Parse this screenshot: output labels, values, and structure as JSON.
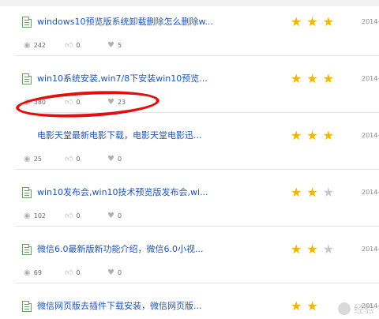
{
  "items": [
    {
      "title": "windows10预览版系统卸载删除怎么删除w...",
      "stars_on": 3,
      "date": "2014-",
      "views": "242",
      "likes": "0",
      "hearts": "5"
    },
    {
      "title": "win10系统安装,win7/8下安装win10预览...",
      "stars_on": 3,
      "date": "2014-",
      "views": "380",
      "likes": "0",
      "hearts": "23"
    },
    {
      "title": "电影天堂最新电影下载，电影天堂电影迅...",
      "stars_on": 3,
      "date": "2014-",
      "views": "25",
      "likes": "0",
      "hearts": "0"
    },
    {
      "title": "win10发布会,win10技术预览版发布会,wi...",
      "stars_on": 2,
      "date": "2014-",
      "views": "102",
      "likes": "0",
      "hearts": "0"
    },
    {
      "title": "微信6.0最新版新功能介绍，微信6.0小视...",
      "stars_on": 2,
      "date": "2014-",
      "views": "69",
      "likes": "0",
      "hearts": "0"
    },
    {
      "title": "微信网页版去插件下载安装，微信网页版...",
      "stars_on": 2,
      "date": "2014-",
      "views": "",
      "likes": "",
      "hearts": ""
    }
  ],
  "watermark": {
    "text": "经验"
  },
  "icons": {
    "view": "eye-icon",
    "like": "thumbs-up-icon",
    "heart": "heart-icon",
    "file": "document-icon"
  },
  "colors": {
    "title_link": "#2255aa",
    "star_on": "#f5b400",
    "star_off": "#c8c8c8",
    "annotation": "#e01010"
  }
}
